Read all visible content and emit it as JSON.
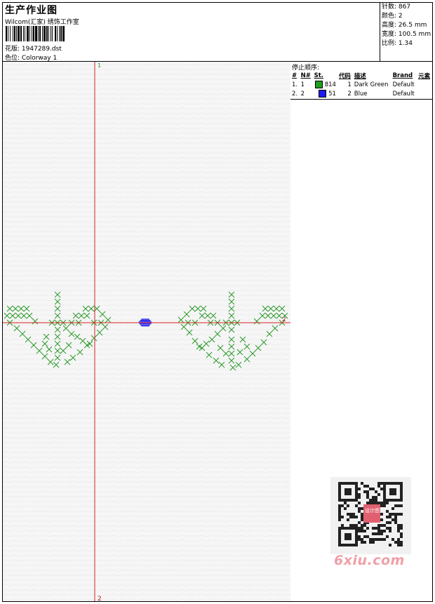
{
  "header": {
    "title": "生产作业图",
    "company": "Wilcom(汇家) 绣饰工作室",
    "pattern_label": "花版:",
    "pattern_value": "1947289.dst",
    "colorway_label": "色位:",
    "colorway_value": "Colorway 1"
  },
  "stats": {
    "stitches_label": "针数:",
    "stitches_value": "867",
    "colors_label": "颜色:",
    "colors_value": "2",
    "height_label": "高度:",
    "height_value": "26.5 mm",
    "width_label": "宽度:",
    "width_value": "100.5 mm",
    "scale_label": "比例:",
    "scale_value": "1.34"
  },
  "stop_sequence": {
    "title": "停止顺序:",
    "columns": [
      "#",
      "N#",
      "St.",
      "代码",
      "描述",
      "Brand",
      "元素"
    ],
    "rows": [
      {
        "index": "1.",
        "needle": "1",
        "color": "#1e9e1e",
        "stitches": "814",
        "code": "1",
        "description": "Dark Green",
        "brand": "Default"
      },
      {
        "index": "2.",
        "needle": "2",
        "color": "#1a1aee",
        "stitches": "51",
        "code": "2",
        "description": "Blue",
        "brand": "Default"
      }
    ]
  },
  "canvas": {
    "axis_top_label": "1",
    "axis_bottom_label": "2",
    "axis_right_label": "2",
    "guide_color": "#d42020",
    "stitch_green": "#2a9a2a",
    "stitch_blue": "#1a1aee"
  },
  "watermark": {
    "text": "6xiu.com",
    "seal_text": "设计图"
  }
}
